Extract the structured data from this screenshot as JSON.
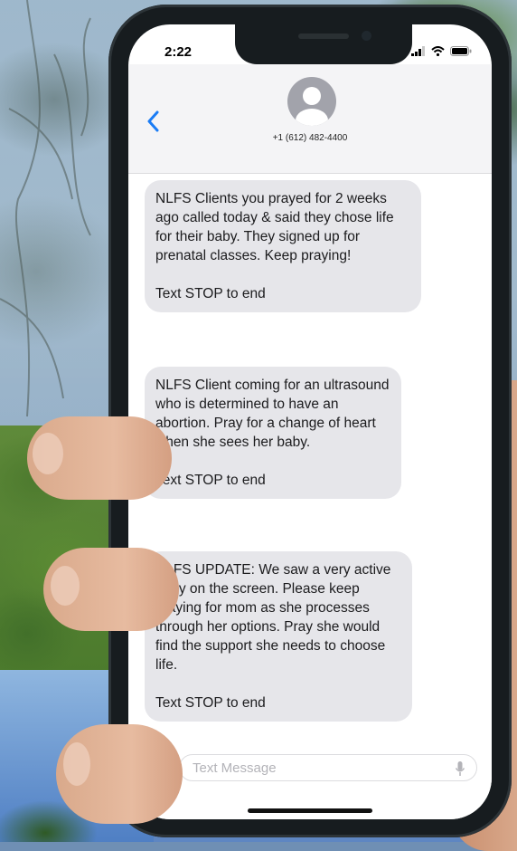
{
  "status_bar": {
    "time": "2:22"
  },
  "header": {
    "contact_number": "+1 (612) 482-4400"
  },
  "messages": [
    {
      "text": "NLFS Clients you prayed for 2 weeks ago called today & said they chose life for their baby. They signed up for prenatal classes. Keep praying!\n\nText STOP to end"
    },
    {
      "text": "NLFS Client coming for an ultrasound who is determined to have an abortion. Pray for a change of heart when she sees her baby.\n\nText STOP to end"
    },
    {
      "text": "NLFS UPDATE: We saw a very active baby on the screen. Please keep praying for mom as she processes through her options. Pray she would find the support she needs to choose life.\n\nText STOP to end"
    }
  ],
  "composer": {
    "plus_label": "+",
    "placeholder": "Text Message"
  },
  "colors": {
    "bubble": "#e6e6ea",
    "accent": "#1a7cf5",
    "phone_frame": "#171c1f"
  },
  "icons": [
    "back-chevron-icon",
    "contact-avatar-icon",
    "signal-icon",
    "wifi-icon",
    "battery-icon",
    "plus-icon",
    "microphone-icon"
  ]
}
